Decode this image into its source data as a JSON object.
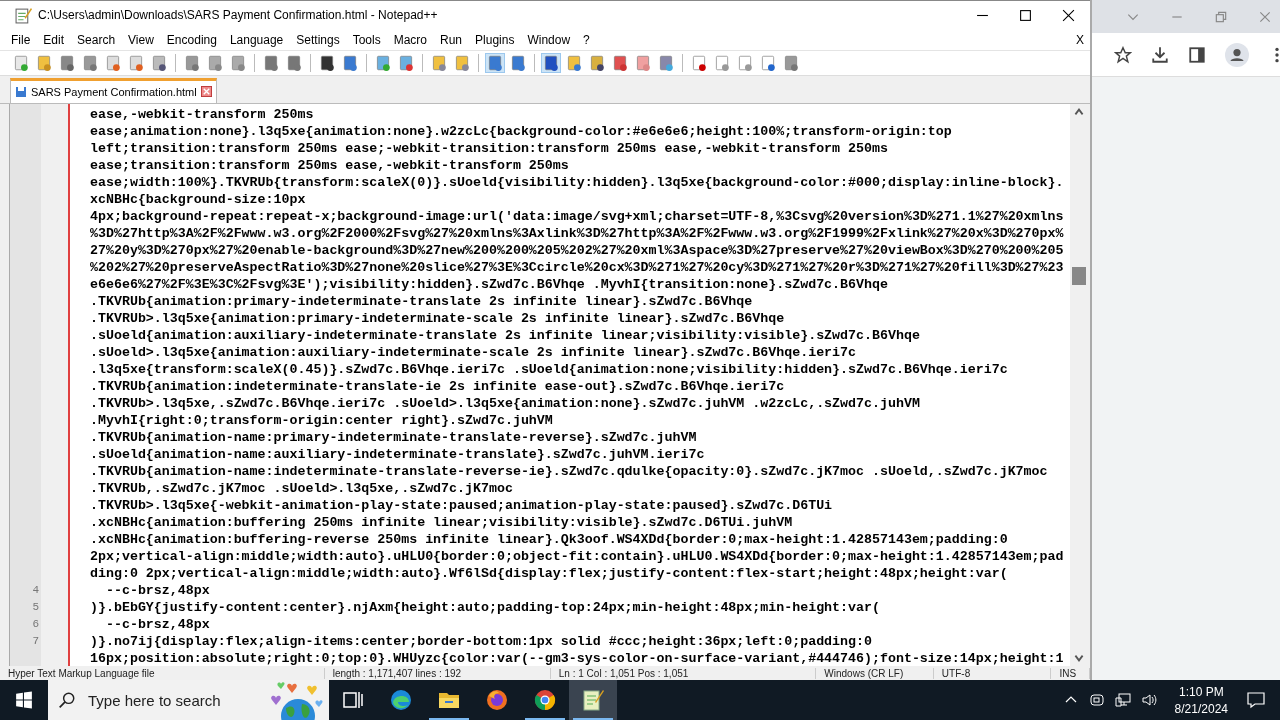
{
  "window": {
    "title": "C:\\Users\\admin\\Downloads\\SARS Payment Confirmation.html - Notepad++"
  },
  "menu": [
    "File",
    "Edit",
    "Search",
    "View",
    "Encoding",
    "Language",
    "Settings",
    "Tools",
    "Macro",
    "Run",
    "Plugins",
    "Window",
    "?"
  ],
  "close_document": "X",
  "tabs": [
    {
      "label": "SARS Payment Confirmation.html",
      "selected": true
    }
  ],
  "editor": {
    "lines": [
      {
        "text": "ease,-webkit-transform 250ms"
      },
      {
        "text": "ease;animation:none}.l3q5xe{animation:none}.w2zcLc{background-color:#e6e6e6;height:100%;transform-origin:top"
      },
      {
        "text": "left;transition:transform 250ms ease;-webkit-transition:transform 250ms ease,-webkit-transform 250ms"
      },
      {
        "text": "ease;transition:transform 250ms ease,-webkit-transform 250ms"
      },
      {
        "text": "ease;width:100%}.TKVRUb{transform:scaleX(0)}.sUoeld{visibility:hidden}.l3q5xe{background-color:#000;display:inline-block}."
      },
      {
        "text": "xcNBHc{background-size:10px"
      },
      {
        "text": "4px;background-repeat:repeat-x;background-image:url('data:image/svg+xml;charset=UTF-8,%3Csvg%20version%3D%271.1%27%20xmlns"
      },
      {
        "text": "%3D%27http%3A%2F%2Fwww.w3.org%2F2000%2Fsvg%27%20xmlns%3Axlink%3D%27http%3A%2F%2Fwww.w3.org%2F1999%2Fxlink%27%20x%3D%270px%"
      },
      {
        "text": "27%20y%3D%270px%27%20enable-background%3D%27new%200%200%205%202%27%20xml%3Aspace%3D%27preserve%27%20viewBox%3D%270%200%205"
      },
      {
        "text": "%202%27%20preserveAspectRatio%3D%27none%20slice%27%3E%3Ccircle%20cx%3D%271%27%20cy%3D%271%27%20r%3D%271%27%20fill%3D%27%23"
      },
      {
        "text": "e6e6e6%27%2F%3E%3C%2Fsvg%3E');visibility:hidden}.sZwd7c.B6Vhqe .MyvhI{transition:none}.sZwd7c.B6Vhqe"
      },
      {
        "text": ".TKVRUb{animation:primary-indeterminate-translate 2s infinite linear}.sZwd7c.B6Vhqe"
      },
      {
        "text": ".TKVRUb>.l3q5xe{animation:primary-indeterminate-scale 2s infinite linear}.sZwd7c.B6Vhqe"
      },
      {
        "text": ".sUoeld{animation:auxiliary-indeterminate-translate 2s infinite linear;visibility:visible}.sZwd7c.B6Vhqe"
      },
      {
        "text": ".sUoeld>.l3q5xe{animation:auxiliary-indeterminate-scale 2s infinite linear}.sZwd7c.B6Vhqe.ieri7c"
      },
      {
        "text": ".l3q5xe{transform:scaleX(0.45)}.sZwd7c.B6Vhqe.ieri7c .sUoeld{animation:none;visibility:hidden}.sZwd7c.B6Vhqe.ieri7c"
      },
      {
        "text": ".TKVRUb{animation:indeterminate-translate-ie 2s infinite ease-out}.sZwd7c.B6Vhqe.ieri7c"
      },
      {
        "text": ".TKVRUb>.l3q5xe,.sZwd7c.B6Vhqe.ieri7c .sUoeld>.l3q5xe{animation:none}.sZwd7c.juhVM .w2zcLc,.sZwd7c.juhVM"
      },
      {
        "text": ".MyvhI{right:0;transform-origin:center right}.sZwd7c.juhVM"
      },
      {
        "text": ".TKVRUb{animation-name:primary-indeterminate-translate-reverse}.sZwd7c.juhVM"
      },
      {
        "text": ".sUoeld{animation-name:auxiliary-indeterminate-translate}.sZwd7c.juhVM.ieri7c"
      },
      {
        "text": ".TKVRUb{animation-name:indeterminate-translate-reverse-ie}.sZwd7c.qdulke{opacity:0}.sZwd7c.jK7moc .sUoeld,.sZwd7c.jK7moc"
      },
      {
        "text": ".TKVRUb,.sZwd7c.jK7moc .sUoeld>.l3q5xe,.sZwd7c.jK7moc"
      },
      {
        "text": ".TKVRUb>.l3q5xe{-webkit-animation-play-state:paused;animation-play-state:paused}.sZwd7c.D6TUi"
      },
      {
        "text": ".xcNBHc{animation:buffering 250ms infinite linear;visibility:visible}.sZwd7c.D6TUi.juhVM"
      },
      {
        "text": ".xcNBHc{animation:buffering-reverse 250ms infinite linear}.Qk3oof.WS4XDd{border:0;max-height:1.42857143em;padding:0"
      },
      {
        "text": "2px;vertical-align:middle;width:auto}.uHLU0{border:0;object-fit:contain}.uHLU0.WS4XDd{border:0;max-height:1.42857143em;pad"
      },
      {
        "text": "ding:0 2px;vertical-align:middle;width:auto}.Wf6lSd{display:flex;justify-content:flex-start;height:48px;height:var("
      },
      {
        "number": "4",
        "text": "  --c-brsz,48px"
      },
      {
        "number": "5",
        "text": ")}.bEbGY{justify-content:center}.njAxm{height:auto;padding-top:24px;min-height:48px;min-height:var("
      },
      {
        "number": "6",
        "text": "  --c-brsz,48px"
      },
      {
        "number": "7",
        "text": ")}.no7ij{display:flex;align-items:center;border-bottom:1px solid #ccc;height:36px;left:0;padding:0"
      },
      {
        "text": "16px;position:absolute;right:0;top:0}.WHUyzc{color:var(--gm3-sys-color-on-surface-variant,#444746);font-size:14px;height:1"
      }
    ]
  },
  "status_bar": [
    "Hyper Text Markup Language file",
    "length : 1,171,407    lines : 192",
    "Ln : 1    Col : 1,051    Pos : 1,051",
    "Windows (CR LF)",
    "UTF-8",
    "INS"
  ],
  "taskbar": {
    "search": {
      "placeholder": "Type here to search"
    },
    "apps": [
      {
        "kind": "task-view",
        "running": false,
        "active": false
      },
      {
        "kind": "edge",
        "running": false,
        "active": false
      },
      {
        "kind": "explorer",
        "running": true,
        "active": false
      },
      {
        "kind": "firefox",
        "running": false,
        "active": false
      },
      {
        "kind": "chrome",
        "running": true,
        "active": false
      },
      {
        "kind": "notepad",
        "running": true,
        "active": true
      }
    ],
    "time": "1:10 PM",
    "date": "8/21/2024"
  }
}
